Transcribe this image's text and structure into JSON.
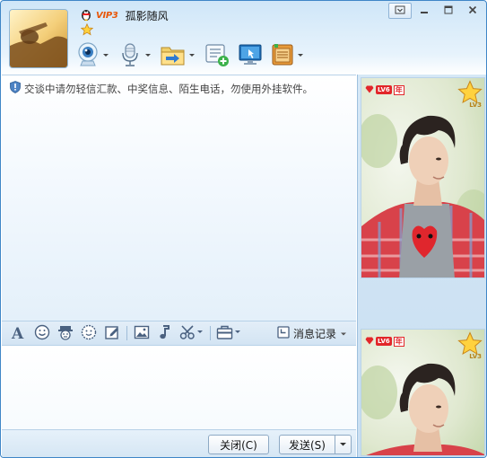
{
  "header": {
    "vip_label": "VIP3",
    "contact_name": "孤影随风"
  },
  "toolbar": {
    "items": [
      {
        "icon": "webcam-icon",
        "has_dropdown": true
      },
      {
        "icon": "microphone-icon",
        "has_dropdown": true
      },
      {
        "icon": "file-transfer-icon",
        "has_dropdown": true
      },
      {
        "icon": "message-add-icon",
        "has_dropdown": false
      },
      {
        "icon": "remote-desktop-icon",
        "has_dropdown": false
      },
      {
        "icon": "app-box-icon",
        "has_dropdown": true
      }
    ]
  },
  "window_controls": [
    "menu-icon",
    "minimize-icon",
    "maximize-icon",
    "close-icon"
  ],
  "chat": {
    "notice": "交谈中请勿轻信汇款、中奖信息、陌生电话，勿使用外挂软件。"
  },
  "format_toolbar": {
    "icons": [
      "font-icon",
      "emoticon-icon",
      "magic-face-icon",
      "smile-face-icon",
      "edit-icon",
      "image-icon",
      "music-icon",
      "scissors-icon",
      "toolbox-icon"
    ],
    "message_record_label": "消息记录"
  },
  "buttons": {
    "close_label": "关闭(C)",
    "send_label": "发送(S)"
  },
  "profile": {
    "level_badge": "LV6",
    "year_badge": "年",
    "star_level": "LV3"
  },
  "colors": {
    "accent": "#3f86c7",
    "vip_orange": "#e8570a",
    "badge_red": "#e2262a",
    "star_gold": "#f5b820"
  }
}
